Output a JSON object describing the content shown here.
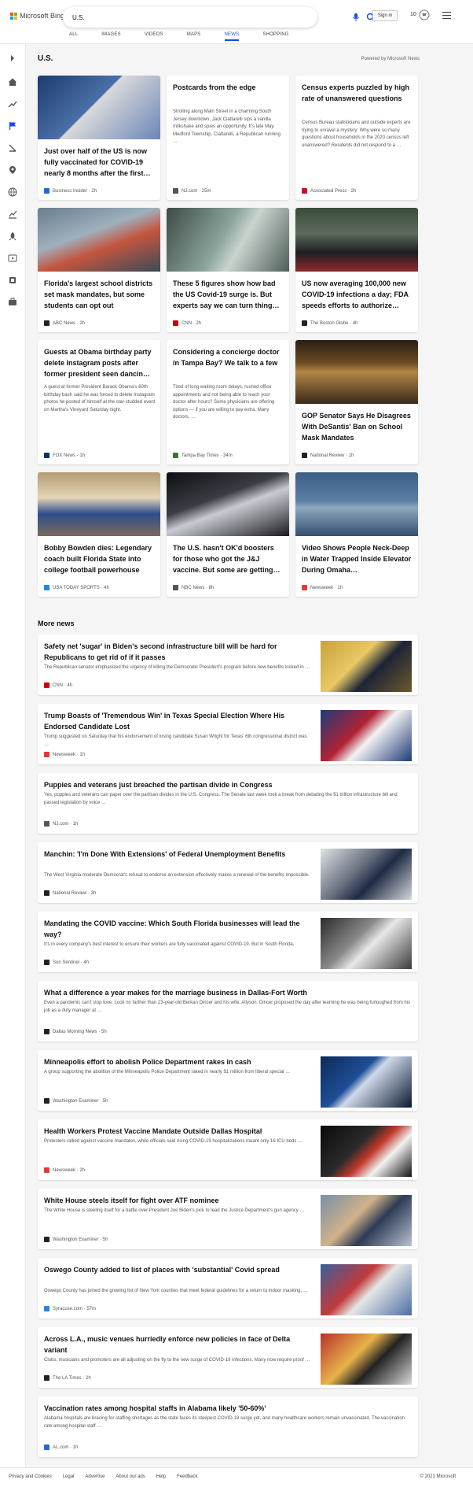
{
  "header": {
    "logo_text": "Microsoft Bing",
    "search_value": "U.S.",
    "signin_label": "Sign in",
    "points": "10",
    "tabs": [
      "ALL",
      "IMAGES",
      "VIDEOS",
      "MAPS",
      "NEWS",
      "SHOPPING"
    ],
    "active_tab": "NEWS"
  },
  "section": {
    "title": "U.S.",
    "powered_by": "Powered by Microsoft News"
  },
  "cards": [
    {
      "title": "Just over half of the US is now fully vaccinated for COVID-19 nearly 8 months after the first…",
      "snippet": "",
      "source": "Business Insider · 2h",
      "source_color": "#1e6bd6",
      "has_image": true
    },
    {
      "title": "Postcards from the edge",
      "snippet": "Strolling along Main Street in a charming South Jersey downtown, Jack Ciattarelli sips a vanilla milkshake and spies an opportunity. It's late May. Medford Township. Ciattarelli, a Republican running …",
      "source": "NJ.com · 25m",
      "source_color": "#555555",
      "has_image": false
    },
    {
      "title": "Census experts puzzled by high rate of unanswered questions",
      "snippet": "Census Bureau statisticians and outside experts are trying to unravel a mystery: Why were so many questions about households in the 2020 census left unanswered? Residents did not respond to a …",
      "source": "Associated Press · 2h",
      "source_color": "#c8102e",
      "has_image": false
    },
    {
      "title": "Florida's largest school districts set mask mandates, but some students can opt out",
      "snippet": "",
      "source": "ABC News · 2h",
      "source_color": "#222222",
      "has_image": true
    },
    {
      "title": "These 5 figures show how bad the US Covid-19 surge is. But experts say we can turn thing…",
      "snippet": "",
      "source": "CNN · 2h",
      "source_color": "#cc0000",
      "has_image": true
    },
    {
      "title": "US now averaging 100,000 new COVID-19 infections a day; FDA speeds efforts to authorize…",
      "snippet": "",
      "source": "The Boston Globe · 4h",
      "source_color": "#222222",
      "has_image": true
    },
    {
      "title": "Guests at Obama birthday party delete Instagram posts after former president seen dancin…",
      "snippet": "A guest at former President Barack Obama's 60th birthday bash said he was forced to delete Instagram photos he posted of himself at the star-studded event on Martha's Vineyard Saturday night.",
      "source": "FOX News · 1h",
      "source_color": "#003366",
      "has_image": false
    },
    {
      "title": "Considering a concierge doctor in Tampa Bay? We talk to a few",
      "snippet": "Tired of long waiting room delays, rushed office appointments and not being able to reach your doctor after hours? Some physicians are offering options — if you are willing to pay extra. Many doctors, …",
      "source": "Tampa Bay Times · 34m",
      "source_color": "#2e7d32",
      "has_image": false
    },
    {
      "title": "GOP Senator Says He Disagrees With DeSantis' Ban on School Mask Mandates",
      "snippet": "",
      "source": "National Review · 1h",
      "source_color": "#222222",
      "has_image": true
    },
    {
      "title": "Bobby Bowden dies: Legendary coach built Florida State into college football powerhouse",
      "snippet": "",
      "source": "USA TODAY SPORTS · 4h",
      "source_color": "#1e88e5",
      "has_image": true
    },
    {
      "title": "The U.S. hasn't OK'd boosters for those who got the J&J vaccine. But some are getting…",
      "snippet": "",
      "source": "NBC News · 8h",
      "source_color": "#555555",
      "has_image": true
    },
    {
      "title": "Video Shows People Neck-Deep in Water Trapped Inside Elevator During Omaha…",
      "snippet": "",
      "source": "Newsweek · 1h",
      "source_color": "#e53935",
      "has_image": true
    }
  ],
  "more_news_title": "More news",
  "more_news": [
    {
      "title": "Safety net 'sugar' in Biden's second infrastructure bill will be hard for Republicans to get rid of if it passes",
      "snippet": "The Republican senator emphasized the urgency of killing the Democratic President's program before new benefits locked in …",
      "source": "CNN · 4h",
      "source_color": "#cc0000",
      "has_image": true
    },
    {
      "title": "Trump Boasts of 'Tremendous Win' in Texas Special Election Where His Endorsed Candidate Lost",
      "snippet": "Trump suggested on Saturday that his endorsement of losing candidate Susan Wright for Texas' 6th congressional district was …",
      "source": "Newsweek · 1h",
      "source_color": "#e53935",
      "has_image": true
    },
    {
      "title": "Puppies and veterans just breached the partisan divide in Congress",
      "snippet": "Yes, puppies and veterans can paper over the partisan divides in the U.S. Congress. The Senate last week took a break from debating the $1 trillion infrastructure bill and passed legislation by voice …",
      "source": "NJ.com · 1h",
      "source_color": "#555555",
      "has_image": false
    },
    {
      "title": "Manchin: 'I'm Done With Extensions' of Federal Unemployment Benefits",
      "snippet": "The West Virginia moderate Democrat's refusal to endorse an extension effectively makes a renewal of the benefits impossible.",
      "source": "National Review · 3h",
      "source_color": "#222222",
      "has_image": true
    },
    {
      "title": "Mandating the COVID vaccine: Which South Florida businesses will lead the way?",
      "snippet": "It's in every company's best interest to ensure their workers are fully vaccinated against COVID-19. But in South Florida,",
      "source": "Sun Sentinel · 4h",
      "source_color": "#222222",
      "has_image": true
    },
    {
      "title": "What a difference a year makes for the marriage business in Dallas-Fort Worth",
      "snippet": "Even a pandemic can't stop love. Look no farther than 23-year-old Berkan Dincer and his wife, Allyson. Dincer proposed the day after learning he was being furloughed from his job as a duty manager at …",
      "source": "Dallas Morning News · 5h",
      "source_color": "#222222",
      "has_image": false
    },
    {
      "title": "Minneapolis effort to abolish Police Department rakes in cash",
      "snippet": "A group supporting the abolition of the Minneapolis Police Department raked in nearly $1 million from liberal special …",
      "source": "Washington Examiner · 5h",
      "source_color": "#222222",
      "has_image": true
    },
    {
      "title": "Health Workers Protest Vaccine Mandate Outside Dallas Hospital",
      "snippet": "Protesters rallied against vaccine mandates, while officials said rising COVID-19 hospitalizations meant only 16 ICU beds …",
      "source": "Newsweek · 2h",
      "source_color": "#e53935",
      "has_image": true
    },
    {
      "title": "White House steels itself for fight over ATF nominee",
      "snippet": "The White House is steeling itself for a battle over President Joe Biden's pick to lead the Justice Department's gun agency …",
      "source": "Washington Examiner · 5h",
      "source_color": "#222222",
      "has_image": true
    },
    {
      "title": "Oswego County added to list of places with 'substantial' Covid spread",
      "snippet": "Oswego County has joined the growing list of New York counties that meet federal guidelines for a return to indoor masking, …",
      "source": "Syracuse.com · 57m",
      "source_color": "#1e88e5",
      "has_image": true
    },
    {
      "title": "Across L.A., music venues hurriedly enforce new policies in face of Delta variant",
      "snippet": "Clubs, musicians and promoters are all adjusting on the fly to the new surge of COVID-19 infections. Many now require proof …",
      "source": "The LA Times · 2h",
      "source_color": "#222222",
      "has_image": true
    },
    {
      "title": "Vaccination rates among hospital staffs in Alabama likely '50-60%'",
      "snippet": "Alabama hospitals are bracing for staffing shortages as the state faces its steepest COVID-19 surge yet, and many healthcare workers remain unvaccinated. The vaccination rate among hospital staff …",
      "source": "AL.com · 1h",
      "source_color": "#1e6bd6",
      "has_image": false
    }
  ],
  "footer": {
    "links": [
      "Privacy and Cookies",
      "Legal",
      "Advertise",
      "About our ads",
      "Help",
      "Feedback"
    ],
    "copyright": "© 2021 Microsoft"
  }
}
